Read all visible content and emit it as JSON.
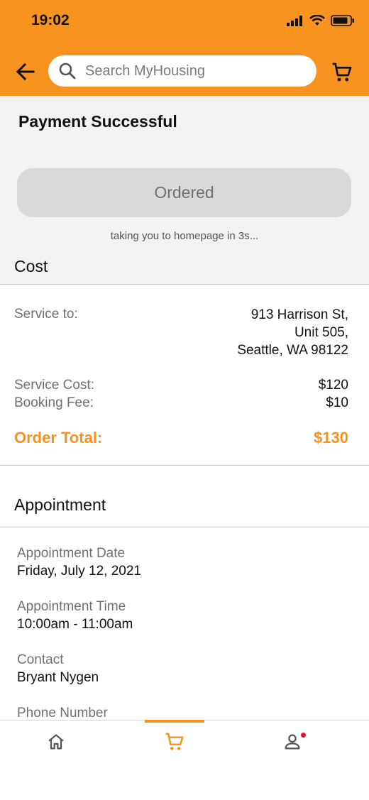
{
  "status_bar": {
    "time": "19:02"
  },
  "header": {
    "search_placeholder": "Search MyHousing"
  },
  "confirmation": {
    "title": "Payment Successful",
    "button_label": "Ordered",
    "redirect_text": "taking you to homepage in 3s..."
  },
  "cost": {
    "heading": "Cost",
    "service_to_label": "Service to:",
    "address_line1": "913 Harrison St,",
    "address_line2": "Unit 505,",
    "address_line3": "Seattle, WA 98122",
    "service_cost_label": "Service Cost:",
    "service_cost_value": "$120",
    "booking_fee_label": "Booking Fee:",
    "booking_fee_value": "$10",
    "order_total_label": "Order Total:",
    "order_total_value": "$130"
  },
  "appointment": {
    "heading": "Appointment",
    "date_label": "Appointment Date",
    "date_value": "Friday, July 12, 2021",
    "time_label": "Appointment Time",
    "time_value": "10:00am - 11:00am",
    "contact_label": "Contact",
    "contact_value": "Bryant Nygen",
    "phone_label": "Phone Number"
  },
  "tabbar": {
    "items": [
      {
        "icon": "home-icon",
        "active": false
      },
      {
        "icon": "cart-icon",
        "active": true
      },
      {
        "icon": "profile-icon",
        "active": false,
        "notification": true
      }
    ]
  },
  "colors": {
    "accent": "#F7931E",
    "notification": "#E0162B",
    "button_disabled": "#D9D9D9"
  }
}
